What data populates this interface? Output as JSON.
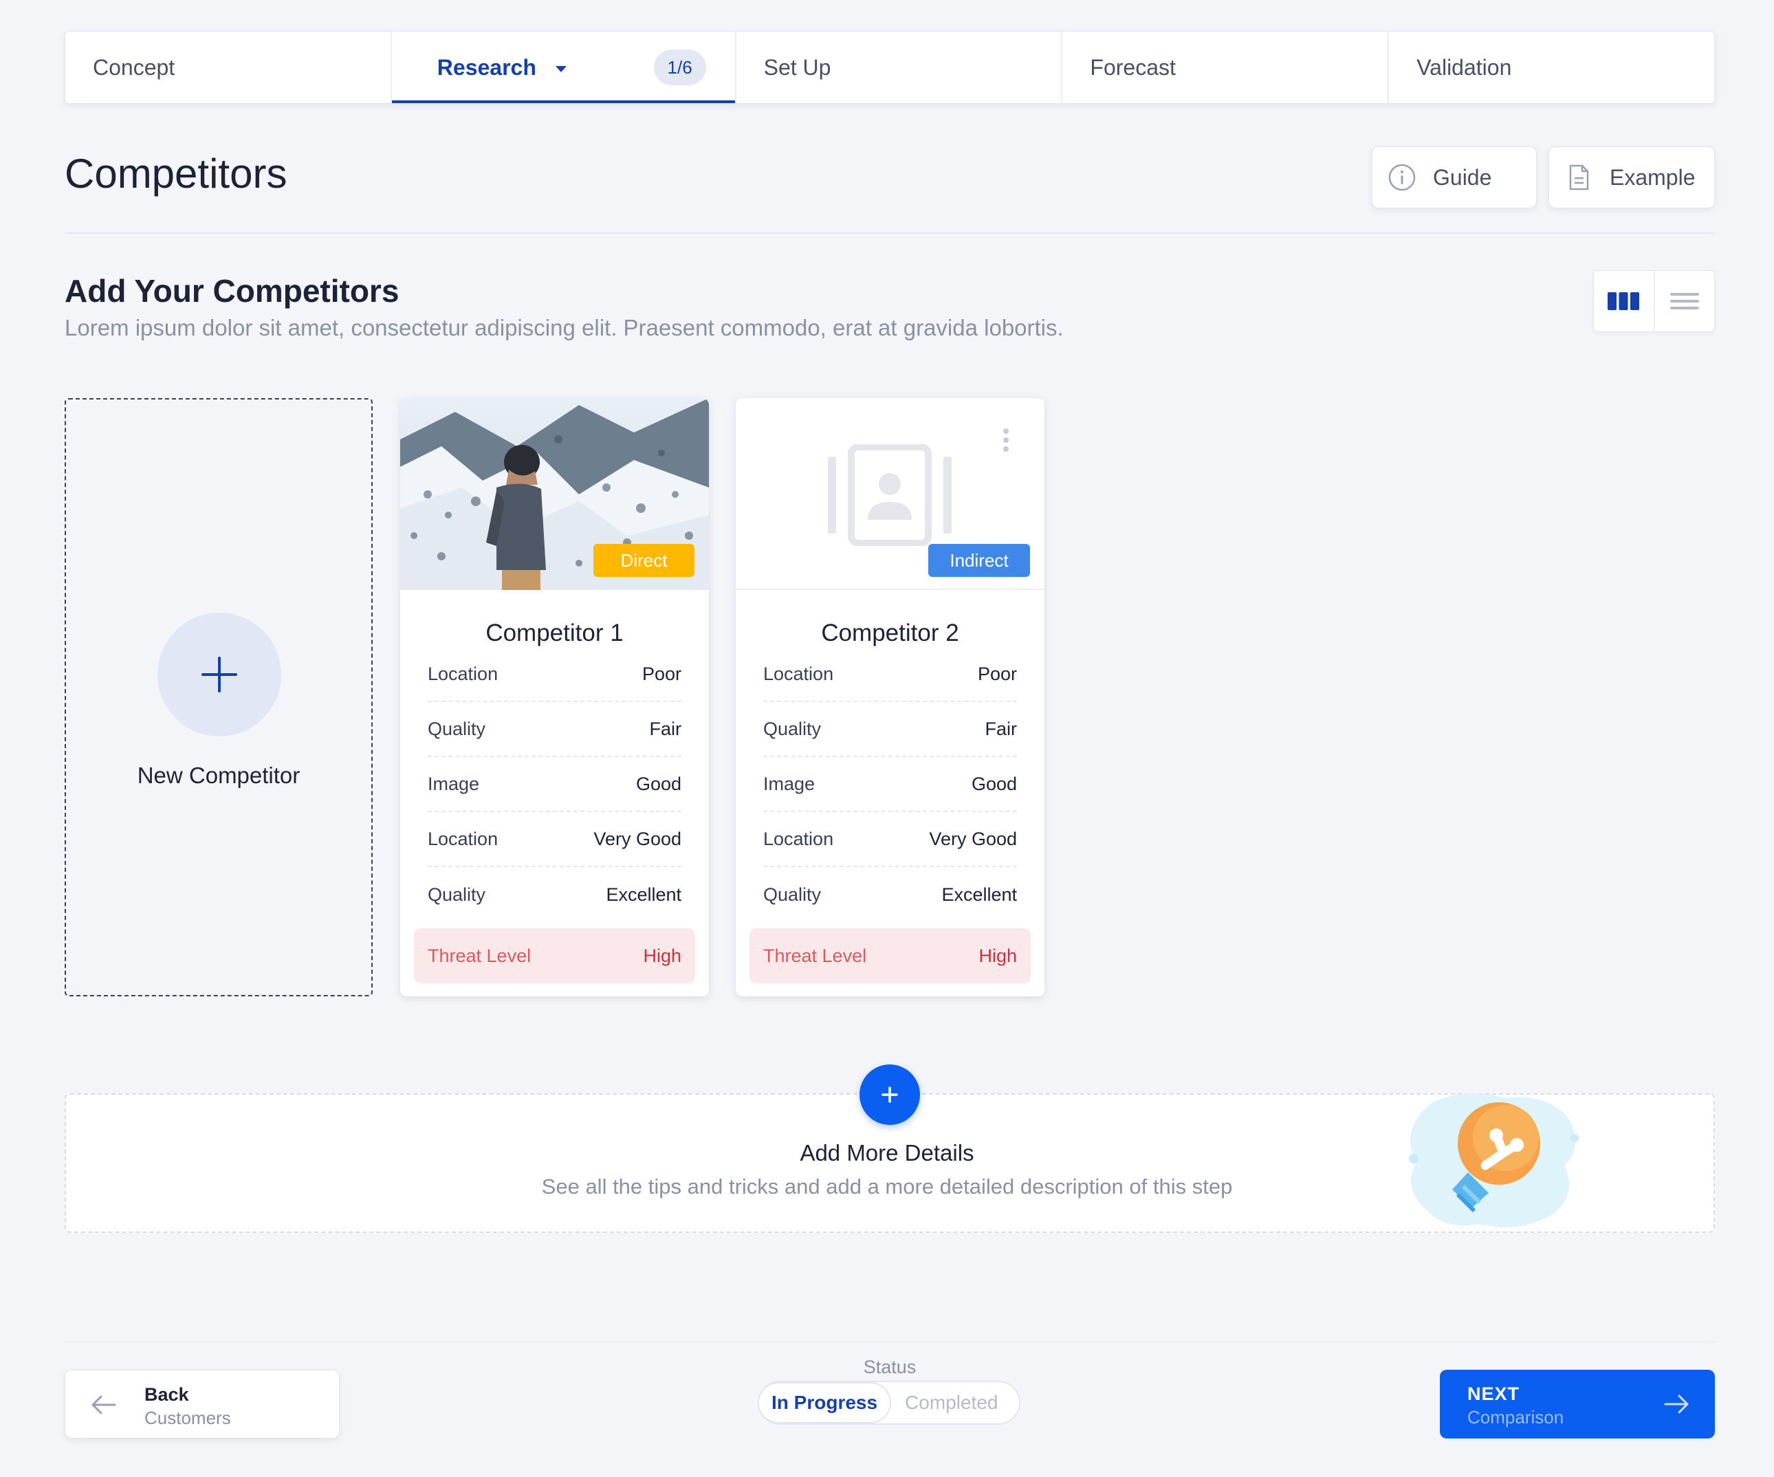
{
  "stepper": {
    "steps": [
      {
        "label": "Concept"
      },
      {
        "label": "Research",
        "active": true,
        "count": "1/6"
      },
      {
        "label": "Set Up"
      },
      {
        "label": "Forecast"
      },
      {
        "label": "Validation"
      }
    ]
  },
  "header": {
    "title": "Competitors",
    "guide_label": "Guide",
    "example_label": "Example"
  },
  "section": {
    "title": "Add Your Competitors",
    "description": "Lorem ipsum dolor sit amet, consectetur adipiscing elit. Praesent commodo, erat at gravida lobortis."
  },
  "new_competitor": {
    "label": "New Competitor"
  },
  "competitors": [
    {
      "name": "Competitor 1",
      "tag": "Direct",
      "tag_color": "#ffb800",
      "rows": [
        {
          "label": "Location",
          "value": "Poor"
        },
        {
          "label": "Quality",
          "value": "Fair"
        },
        {
          "label": "Image",
          "value": "Good"
        },
        {
          "label": "Location",
          "value": "Very Good"
        },
        {
          "label": "Quality",
          "value": "Excellent"
        }
      ],
      "threat": {
        "label": "Threat Level",
        "value": "High"
      }
    },
    {
      "name": "Competitor 2",
      "tag": "Indirect",
      "tag_color": "#3f87e8",
      "rows": [
        {
          "label": "Location",
          "value": "Poor"
        },
        {
          "label": "Quality",
          "value": "Fair"
        },
        {
          "label": "Image",
          "value": "Good"
        },
        {
          "label": "Location",
          "value": "Very Good"
        },
        {
          "label": "Quality",
          "value": "Excellent"
        }
      ],
      "threat": {
        "label": "Threat Level",
        "value": "High"
      }
    }
  ],
  "details": {
    "title": "Add More Details",
    "description": "See all the tips and tricks and add a more detailed description of this step"
  },
  "footer": {
    "back_label": "Back",
    "back_sub": "Customers",
    "status_label": "Status",
    "status_in_progress": "In Progress",
    "status_completed": "Completed",
    "next_label": "NEXT",
    "next_sub": "Comparison"
  },
  "colors": {
    "accent": "#173fa8",
    "primary_button": "#0a5ff0",
    "threat_bg": "#fbe8ea",
    "threat_text": "#c8333b"
  }
}
